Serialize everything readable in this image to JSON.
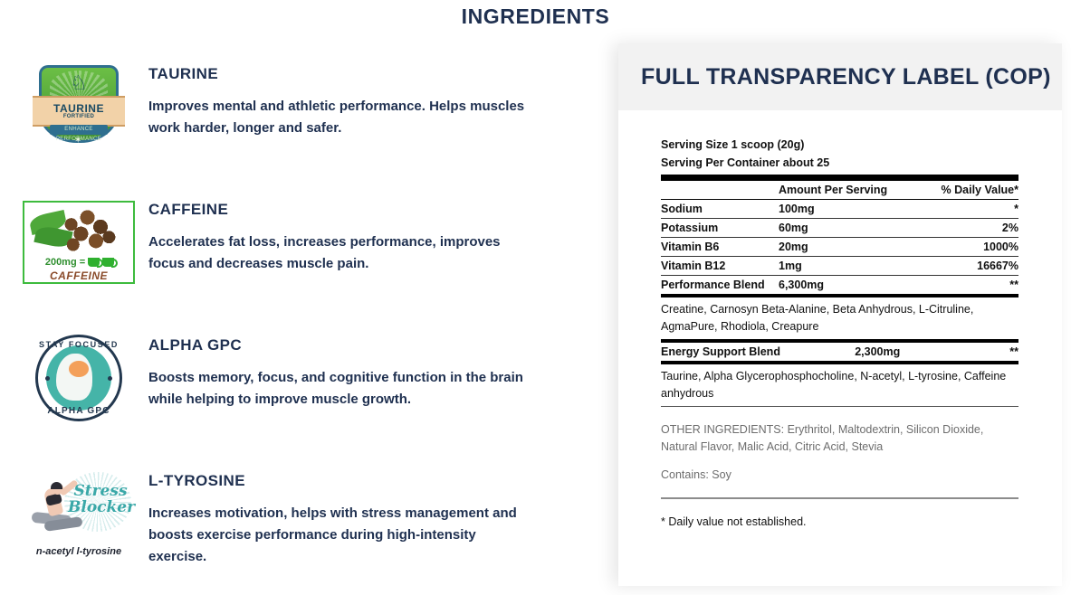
{
  "page": {
    "title": "INGREDIENTS"
  },
  "ingredients": [
    {
      "name": "TAURINE",
      "description": "Improves mental and athletic performance. Helps muscles work harder, longer and safer.",
      "badge": {
        "icon": "taurine-shield-badge",
        "primary_text": "TAURINE",
        "secondary_text": "FORTIFIED",
        "tag_text": "ENHANCE PERFORMANCE"
      }
    },
    {
      "name": "CAFFEINE",
      "description": "Accelerates fat loss, increases performance, improves focus and decreases muscle pain.",
      "badge": {
        "icon": "coffee-beans-badge",
        "dose_text": "200mg =",
        "caption": "CAFFEINE"
      }
    },
    {
      "name": "ALPHA GPC",
      "description": "Boosts memory, focus, and cognitive function in the brain while helping to improve muscle growth.",
      "badge": {
        "icon": "brain-focus-badge",
        "top_text": "STAY FOCUSED",
        "bottom_text": "ALPHA GPC"
      }
    },
    {
      "name": "L-TYROSINE",
      "description": "Increases motivation, helps with stress management and boosts exercise performance during high-intensity exercise.",
      "badge": {
        "icon": "yoga-stress-blocker-badge",
        "script_text": "Stress Blocker",
        "caption": "n-acetyl l-tyrosine"
      }
    }
  ],
  "label_panel": {
    "title": "FULL TRANSPARENCY LABEL (COP)",
    "serving_size": "Serving Size 1 scoop (20g)",
    "serving_per_container": "Serving Per Container about 25",
    "columns": {
      "name": "",
      "amount": "Amount Per Serving",
      "daily_value": "% Daily Value*"
    },
    "rows": [
      {
        "name": "Sodium",
        "amount": "100mg",
        "dv": "*"
      },
      {
        "name": "Potassium",
        "amount": "60mg",
        "dv": "2%"
      },
      {
        "name": "Vitamin B6",
        "amount": "20mg",
        "dv": "1000%"
      },
      {
        "name": "Vitamin B12",
        "amount": "1mg",
        "dv": "16667%"
      },
      {
        "name": "Performance Blend",
        "amount": "6,300mg",
        "dv": "**"
      }
    ],
    "performance_blend_ingredients": "Creatine, Carnosyn Beta-Alanine, Beta Anhydrous, L-Citruline, AgmaPure, Rhodiola, Creapure",
    "energy_blend_row": {
      "name": "Energy Support Blend",
      "amount": "2,300mg",
      "dv": "**"
    },
    "energy_blend_ingredients": "Taurine, Alpha Glycerophosphocholine, N-acetyl, L-tyrosine, Caffeine anhydrous",
    "other_ingredients": "OTHER INGREDIENTS: Erythritol, Maltodextrin, Silicon Dioxide, Natural Flavor, Malic Acid, Citric Acid, Stevia",
    "contains": "Contains: Soy",
    "footnote": "* Daily value not established."
  },
  "colors": {
    "heading_navy": "#1f3050",
    "panel_header_gray": "#f2f2f2",
    "muted_gray": "#6d6d6d",
    "accent_green": "#3dbb3d",
    "accent_teal": "#3aa8a8"
  }
}
